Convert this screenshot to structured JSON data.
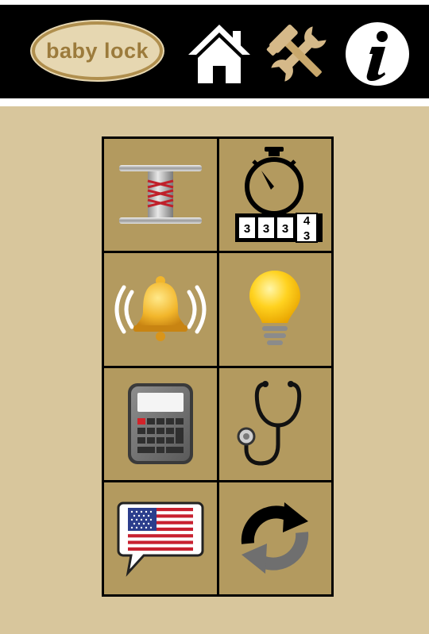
{
  "header": {
    "logo_text": "baby lock",
    "buttons": [
      {
        "name": "home",
        "icon": "home-icon"
      },
      {
        "name": "settings",
        "icon": "tools-icon"
      },
      {
        "name": "info",
        "icon": "info-icon"
      }
    ]
  },
  "colors": {
    "header_bg": "#000000",
    "panel_bg": "#d8c69c",
    "tile_bg": "#b39a5f",
    "logo_gold": "#b08f4e",
    "logo_fill": "#e6d7b1"
  },
  "menu": {
    "tiles": [
      {
        "id": "bobbin",
        "icon": "bobbin-icon"
      },
      {
        "id": "stitch-counter",
        "icon": "stopwatch-counter-icon",
        "counter_digits": [
          "3",
          "3",
          "3",
          "4",
          "3"
        ]
      },
      {
        "id": "alarm",
        "icon": "ringing-bell-icon"
      },
      {
        "id": "light",
        "icon": "light-bulb-icon"
      },
      {
        "id": "calculator",
        "icon": "calculator-icon"
      },
      {
        "id": "diagnostics",
        "icon": "stethoscope-icon"
      },
      {
        "id": "language",
        "icon": "us-flag-speech-icon"
      },
      {
        "id": "reset",
        "icon": "refresh-icon"
      }
    ]
  }
}
